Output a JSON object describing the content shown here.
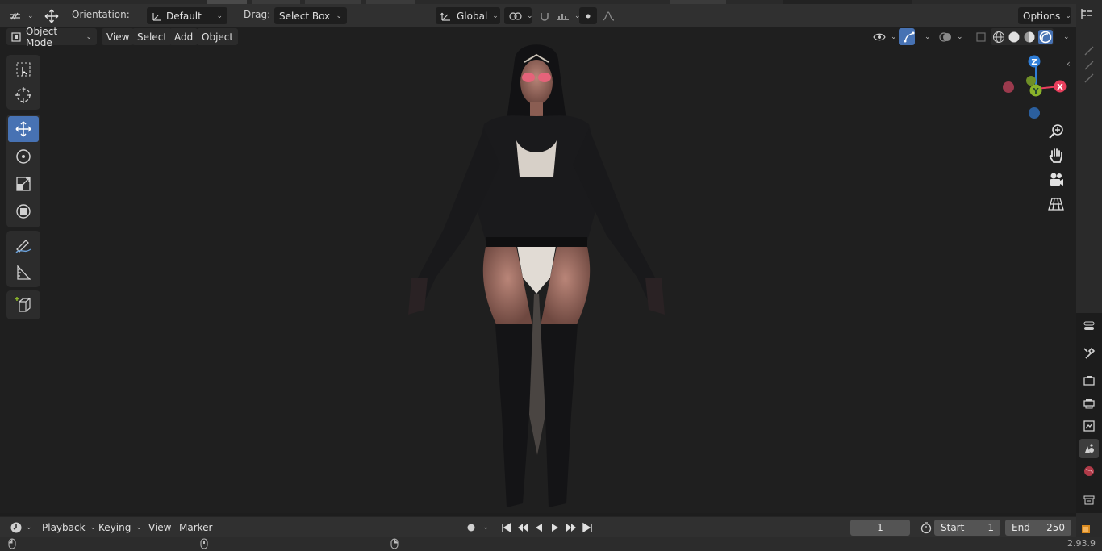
{
  "tool_header": {
    "orientation_label": "Orientation:",
    "orientation_value": "Default",
    "drag_label": "Drag:",
    "drag_value": "Select Box",
    "transform_orientation": "Global",
    "options_label": "Options"
  },
  "viewport_header": {
    "mode": "Object Mode",
    "menus": [
      "View",
      "Select",
      "Add",
      "Object"
    ]
  },
  "gizmo": {
    "z_label": "Z",
    "y_label": "Y",
    "x_label": "X"
  },
  "timeline": {
    "menus": [
      "Playback",
      "Keying",
      "View",
      "Marker"
    ],
    "current_frame": "1",
    "start_label": "Start",
    "start_value": "1",
    "end_label": "End",
    "end_value": "250"
  },
  "status": {
    "version": "2.93.9"
  },
  "colors": {
    "accent": "#4772b3",
    "axis_x": "#e83e5c",
    "axis_y": "#8ab32a",
    "axis_z": "#2f7ed8",
    "viewport_bg": "#1f1f1f"
  },
  "icons": [
    "editor-type-icon",
    "move-gizmo-icon",
    "orientation-icon",
    "global-icon",
    "pivot-icon",
    "snap-icon",
    "proportional-icon",
    "select-box-tool-icon",
    "cursor-tool-icon",
    "move-tool-icon",
    "rotate-tool-icon",
    "scale-tool-icon",
    "transform-tool-icon",
    "annotate-tool-icon",
    "measure-tool-icon",
    "add-cube-tool-icon",
    "zoom-icon",
    "hand-icon",
    "camera-icon",
    "grid-icon",
    "tool-properties-icon",
    "render-properties-icon",
    "output-properties-icon",
    "view-layer-icon",
    "scene-properties-icon",
    "world-properties-icon",
    "collection-properties-icon",
    "object-properties-icon"
  ]
}
